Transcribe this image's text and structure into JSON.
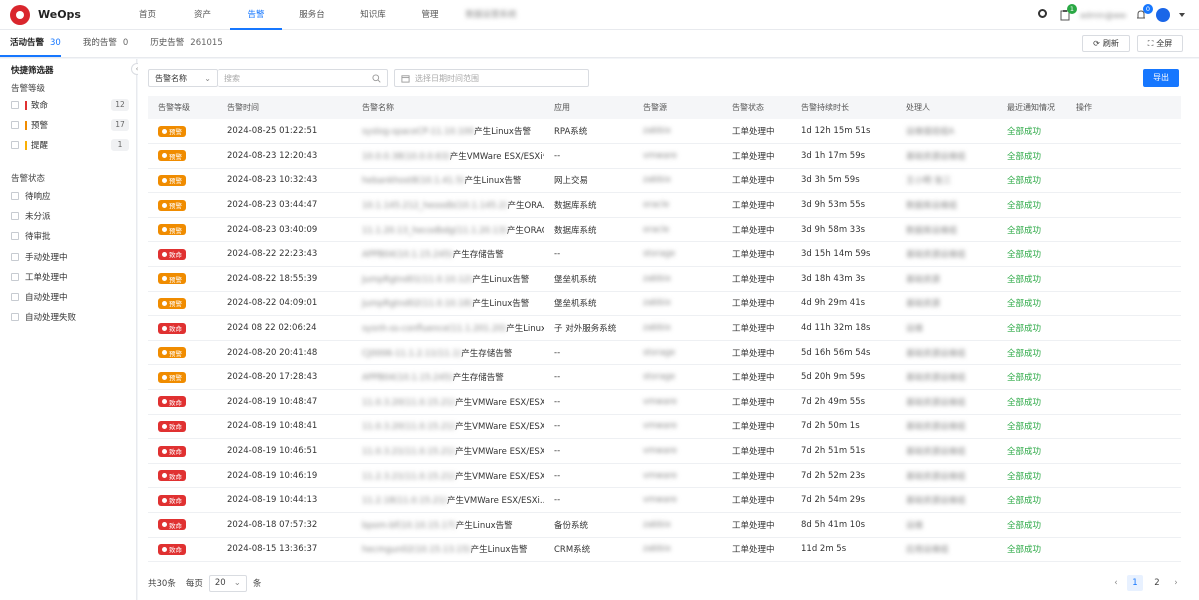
{
  "app": {
    "name": "WeOps",
    "brand_color": "#d9262d",
    "accent": "#1677ff"
  },
  "nav": [
    {
      "label": "首页",
      "active": false
    },
    {
      "label": "资产",
      "active": false
    },
    {
      "label": "告警",
      "active": true
    },
    {
      "label": "服务台",
      "active": false
    },
    {
      "label": "知识库",
      "active": false
    },
    {
      "label": "管理",
      "active": false
    },
    {
      "label": "数据运营系统",
      "active": false,
      "blurred": true
    }
  ],
  "header_right": {
    "theme_icon": "sun-icon",
    "todo_badge": "1",
    "todo_badge_color": "#2aa844",
    "user_name": "admin@weops",
    "bell_badge": "0",
    "bell_badge_color": "#1677ff"
  },
  "tabs": [
    {
      "label": "活动告警",
      "count": "30",
      "active": true
    },
    {
      "label": "我的告警",
      "count": "0",
      "active": false
    },
    {
      "label": "历史告警",
      "count": "261015",
      "active": false
    }
  ],
  "toolbar": {
    "refresh": "刷新",
    "fullscreen": "全屏",
    "export": "导出"
  },
  "filters": {
    "field_select": "告警名称",
    "search_placeholder": "搜索",
    "date_placeholder": "选择日期时间范围"
  },
  "sidebar": {
    "title": "快捷筛选器",
    "level_title": "告警等级",
    "levels": [
      {
        "label": "致命",
        "count": "12",
        "color": "#e03131"
      },
      {
        "label": "预警",
        "count": "17",
        "color": "#f08c00"
      },
      {
        "label": "提醒",
        "count": "1",
        "color": "#fab005"
      }
    ],
    "status_title": "告警状态",
    "statuses": [
      "待响应",
      "未分派",
      "待审批",
      "手动处理中",
      "工单处理中",
      "自动处理中",
      "自动处理失败"
    ]
  },
  "table": {
    "columns": [
      "告警等级",
      "告警时间",
      "告警名称",
      "应用",
      "告警源",
      "告警状态",
      "告警持续时长",
      "处理人",
      "最近通知情况",
      "操作"
    ],
    "level_colors": {
      "预警": "#f08c00",
      "致命": "#e03131"
    },
    "rows": [
      {
        "level": "预警",
        "time": "2024-08-25 01:22:51",
        "name_prefix": "syslog-spaceCP-11.10.100",
        "name": "产生Linux告警",
        "app": "RPA系统",
        "source": "zabbix",
        "status": "工单处理中",
        "duration": "1d 12h 15m 51s",
        "handler": "运维值班组A",
        "notify": "全部成功"
      },
      {
        "level": "预警",
        "time": "2024-08-23 12:20:43",
        "name_prefix": "10.0.0.38(10.0.0.63)",
        "name": "产生VMWare ESX/ESXi告警",
        "app": "--",
        "source": "vmware",
        "status": "工单处理中",
        "duration": "3d 1h 17m 59s",
        "handler": "基础资源运维组",
        "notify": "全部成功"
      },
      {
        "level": "预警",
        "time": "2024-08-23 10:32:43",
        "name_prefix": "hebankhost8(10.1.41.5)",
        "name": "产生Linux告警",
        "app": "网上交易",
        "source": "zabbix",
        "status": "工单处理中",
        "duration": "3d 3h 5m 59s",
        "handler": "王小明 张三",
        "notify": "全部成功"
      },
      {
        "level": "预警",
        "time": "2024-08-23 03:44:47",
        "name_prefix": "10.1.145.212_heoodb(10.1.145.2)",
        "name": "产生ORA...",
        "app": "数据库系统",
        "source": "oracle",
        "status": "工单处理中",
        "duration": "3d 9h 53m 55s",
        "handler": "数据库运维组",
        "notify": "全部成功"
      },
      {
        "level": "预警",
        "time": "2024-08-23 03:40:09",
        "name_prefix": "11.1.20.13_hecodbdg(11.1.20.13)",
        "name": "产生ORACL...",
        "app": "数据库系统",
        "source": "oracle",
        "status": "工单处理中",
        "duration": "3d 9h 58m 33s",
        "handler": "数据库运维组",
        "notify": "全部成功"
      },
      {
        "level": "致命",
        "time": "2024-08-22 22:23:43",
        "name_prefix": "APPB04(10.1.15.245)",
        "name": "产生存储告警",
        "app": "--",
        "source": "storage",
        "status": "工单处理中",
        "duration": "3d 15h 14m 59s",
        "handler": "基础资源运维组",
        "notify": "全部成功"
      },
      {
        "level": "预警",
        "time": "2024-08-22 18:55:39",
        "name_prefix": "JumpRgtnd01(11.0.10.12)",
        "name": "产生Linux告警",
        "app": "堡垒机系统",
        "source": "zabbix",
        "status": "工单处理中",
        "duration": "3d 18h 43m 3s",
        "handler": "基础资源",
        "notify": "全部成功"
      },
      {
        "level": "预警",
        "time": "2024-08-22 04:09:01",
        "name_prefix": "JumpRgtnd02(11.0.10.18)",
        "name": "产生Linux告警",
        "app": "堡垒机系统",
        "source": "zabbix",
        "status": "工单处理中",
        "duration": "4d 9h 29m 41s",
        "handler": "基础资源",
        "notify": "全部成功"
      },
      {
        "level": "致命",
        "time": "2024 08 22 02:06:24",
        "name_prefix": "sysnh-ss-confluence(11.1.201.20)",
        "name": "产生Linux告警",
        "app": "子 对外服务系统",
        "source": "zabbix",
        "status": "工单处理中",
        "duration": "4d 11h 32m 18s",
        "handler": "运维",
        "notify": "全部成功"
      },
      {
        "level": "预警",
        "time": "2024-08-20 20:41:48",
        "name_prefix": "CJ0006-11.1.2.11(11.1)",
        "name": "产生存储告警",
        "app": "--",
        "source": "storage",
        "status": "工单处理中",
        "duration": "5d 16h 56m 54s",
        "handler": "基础资源运维组",
        "notify": "全部成功"
      },
      {
        "level": "预警",
        "time": "2024-08-20 17:28:43",
        "name_prefix": "APPB04(10.1.15.245)",
        "name": "产生存储告警",
        "app": "--",
        "source": "storage",
        "status": "工单处理中",
        "duration": "5d 20h 9m 59s",
        "handler": "基础资源运维组",
        "notify": "全部成功"
      },
      {
        "level": "致命",
        "time": "2024-08-19 10:48:47",
        "name_prefix": "11.0.3.20(11.0.15.21)",
        "name": "产生VMWare ESX/ESXi...",
        "app": "--",
        "source": "vmware",
        "status": "工单处理中",
        "duration": "7d 2h 49m 55s",
        "handler": "基础资源运维组",
        "notify": "全部成功"
      },
      {
        "level": "致命",
        "time": "2024-08-19 10:48:41",
        "name_prefix": "11.0.3.20(11.0.15.21)",
        "name": "产生VMWare ESX/ESXi告...",
        "app": "--",
        "source": "vmware",
        "status": "工单处理中",
        "duration": "7d 2h 50m 1s",
        "handler": "基础资源运维组",
        "notify": "全部成功"
      },
      {
        "level": "致命",
        "time": "2024-08-19 10:46:51",
        "name_prefix": "11.0.3.21(11.0.15.21)",
        "name": "产生VMWare ESX/ESXi告...",
        "app": "--",
        "source": "vmware",
        "status": "工单处理中",
        "duration": "7d 2h 51m 51s",
        "handler": "基础资源运维组",
        "notify": "全部成功"
      },
      {
        "level": "致命",
        "time": "2024-08-19 10:46:19",
        "name_prefix": "11.2.3.21(11.0.15.21)",
        "name": "产生VMWare ESX/ESXi告...",
        "app": "--",
        "source": "vmware",
        "status": "工单处理中",
        "duration": "7d 2h 52m 23s",
        "handler": "基础资源运维组",
        "notify": "全部成功"
      },
      {
        "level": "致命",
        "time": "2024-08-19 10:44:13",
        "name_prefix": "11.2.18(11.0.15.21)",
        "name": "产生VMWare ESX/ESXi...",
        "app": "--",
        "source": "vmware",
        "status": "工单处理中",
        "duration": "7d 2h 54m 29s",
        "handler": "基础资源运维组",
        "notify": "全部成功"
      },
      {
        "level": "致命",
        "time": "2024-08-18 07:57:32",
        "name_prefix": "bpom-bf(10.10.15.17)",
        "name": "产生Linux告警",
        "app": "备份系统",
        "source": "zabbix",
        "status": "工单处理中",
        "duration": "8d 5h 41m 10s",
        "handler": "运维",
        "notify": "全部成功"
      },
      {
        "level": "致命",
        "time": "2024-08-15 13:36:37",
        "name_prefix": "hecmgun02(10.15.13.15)",
        "name": "产生Linux告警",
        "app": "CRM系统",
        "source": "zabbix",
        "status": "工单处理中",
        "duration": "11d 2m 5s",
        "handler": "应用运维组",
        "notify": "全部成功"
      }
    ]
  },
  "pager": {
    "total": "共30条",
    "per_page_label": "每页",
    "per_page": "20",
    "unit": "条",
    "pages": [
      "1",
      "2"
    ],
    "current": "1"
  }
}
